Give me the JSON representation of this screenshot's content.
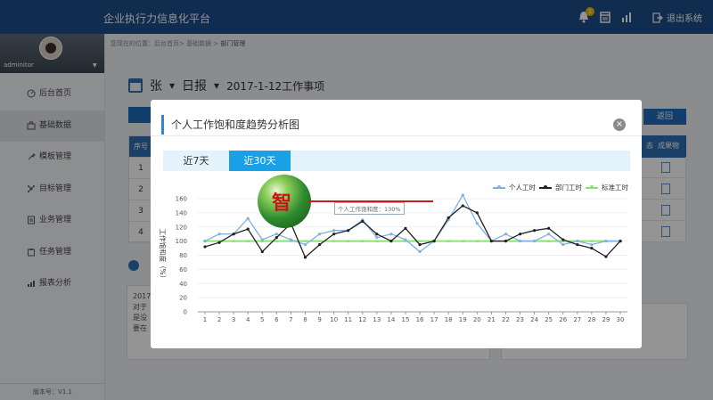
{
  "header": {
    "app_title": "企业执行力信息化平台",
    "notification_count": "1",
    "logout_label": "退出系统"
  },
  "sidebar": {
    "username": "adminitor",
    "items": [
      {
        "label": "后台首页"
      },
      {
        "label": "基础数据"
      },
      {
        "label": "模板管理"
      },
      {
        "label": "目标管理"
      },
      {
        "label": "业务管理"
      },
      {
        "label": "任务管理"
      },
      {
        "label": "报表分析"
      }
    ],
    "version": "版本号：V1.1"
  },
  "breadcrumb": {
    "prefix": "您现在的位置：后台首页> 基础数据 >",
    "current": "部门管理"
  },
  "page": {
    "person": "张",
    "report_type": "日报",
    "title": "2017-1-12工作事项",
    "back_button": "返回",
    "table_header_index": "序号",
    "table_header_result": "成果物",
    "table_header_partial": "态",
    "rows": [
      "1",
      "2",
      "3",
      "4"
    ],
    "panel_date": "2017-",
    "panel_lines": [
      "对于",
      "是没",
      "要在"
    ]
  },
  "modal": {
    "title": "个人工作饱和度趋势分析图",
    "close_label": "×",
    "tabs": [
      {
        "label": "近7天",
        "active": false
      },
      {
        "label": "近30天",
        "active": true
      }
    ],
    "tooltip": "个人工作饱和度：130%",
    "logo_char": "智"
  },
  "chart_data": {
    "type": "line",
    "ylabel": "工作饱和度（%）",
    "ylim": [
      0,
      160
    ],
    "yticks": [
      0,
      20,
      40,
      60,
      80,
      100,
      120,
      140,
      160
    ],
    "x": [
      1,
      2,
      3,
      4,
      5,
      6,
      7,
      8,
      9,
      10,
      11,
      12,
      13,
      14,
      15,
      16,
      17,
      18,
      19,
      20,
      21,
      22,
      23,
      24,
      25,
      26,
      27,
      28,
      29,
      30
    ],
    "legend_position": "top-right",
    "grid": true,
    "series": [
      {
        "name": "个人工时",
        "color": "#7fb2e2",
        "values": [
          100,
          110,
          110,
          132,
          102,
          110,
          102,
          95,
          110,
          115,
          115,
          130,
          105,
          110,
          102,
          85,
          100,
          130,
          165,
          125,
          100,
          110,
          100,
          100,
          110,
          95,
          100,
          95,
          100,
          100
        ]
      },
      {
        "name": "部门工时",
        "color": "#222222",
        "values": [
          92,
          98,
          110,
          117,
          85,
          105,
          125,
          77,
          95,
          110,
          115,
          128,
          110,
          100,
          118,
          95,
          100,
          133,
          150,
          140,
          100,
          100,
          110,
          115,
          118,
          102,
          95,
          90,
          78,
          100
        ]
      },
      {
        "name": "标准工时",
        "color": "#8ee07a",
        "values": [
          100,
          100,
          100,
          100,
          100,
          100,
          100,
          100,
          100,
          100,
          100,
          100,
          100,
          100,
          100,
          100,
          100,
          100,
          100,
          100,
          100,
          100,
          100,
          100,
          100,
          100,
          100,
          100,
          100,
          100
        ]
      }
    ]
  }
}
